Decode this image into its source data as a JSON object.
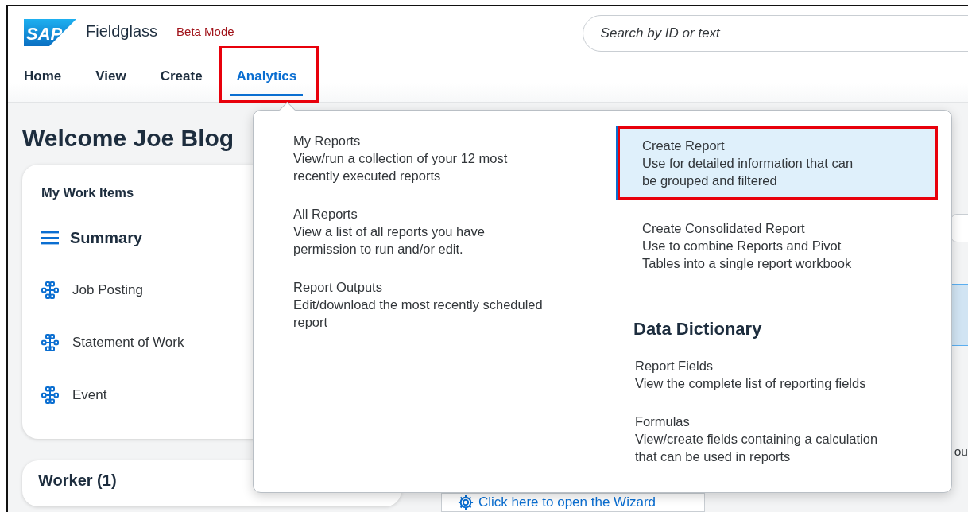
{
  "header": {
    "logo": "SAP",
    "product": "Fieldglass",
    "mode_badge": "Beta Mode",
    "search": {
      "placeholder": "Search by ID or text"
    }
  },
  "nav": [
    {
      "label": "Home",
      "selected": false,
      "highlighted": false
    },
    {
      "label": "View",
      "selected": false,
      "highlighted": false
    },
    {
      "label": "Create",
      "selected": false,
      "highlighted": false
    },
    {
      "label": "Analytics",
      "selected": true,
      "highlighted": true
    }
  ],
  "page": {
    "welcome": "Welcome Joe Blog",
    "work_items": {
      "title": "My Work Items",
      "summary": "Summary",
      "items": [
        "Job Posting",
        "Statement of Work",
        "Event"
      ]
    },
    "worker": {
      "title": "Worker (1)"
    },
    "side_text_fragment": "ou",
    "wizard_link": "Click here to open the Wizard"
  },
  "menu": {
    "columns": [
      {
        "items": [
          {
            "title": "My Reports",
            "description": "View/run a collection of your 12 most\nrecently executed reports",
            "selected": false,
            "highlighted": false
          },
          {
            "title": "All Reports",
            "description": "View a list of all reports you have\npermission to run and/or edit.",
            "selected": false,
            "highlighted": false
          },
          {
            "title": "Report Outputs",
            "description": "Edit/download the most recently scheduled\nreport",
            "selected": false,
            "highlighted": false
          }
        ]
      },
      {
        "items": [
          {
            "title": "Create Report",
            "description": "Use for detailed information that can\nbe grouped and filtered",
            "selected": true,
            "highlighted": true
          },
          {
            "title": "Create Consolidated Report",
            "description": "Use to combine Reports and Pivot\nTables into a single report workbook",
            "selected": false,
            "highlighted": false
          }
        ],
        "section": {
          "heading": "Data Dictionary",
          "items": [
            {
              "title": "Report Fields",
              "description": "View the complete list of reporting fields",
              "selected": false,
              "highlighted": false
            },
            {
              "title": "Formulas",
              "description": "View/create fields containing a calculation\nthat can be used in reports",
              "selected": false,
              "highlighted": false
            }
          ]
        }
      }
    ]
  }
}
